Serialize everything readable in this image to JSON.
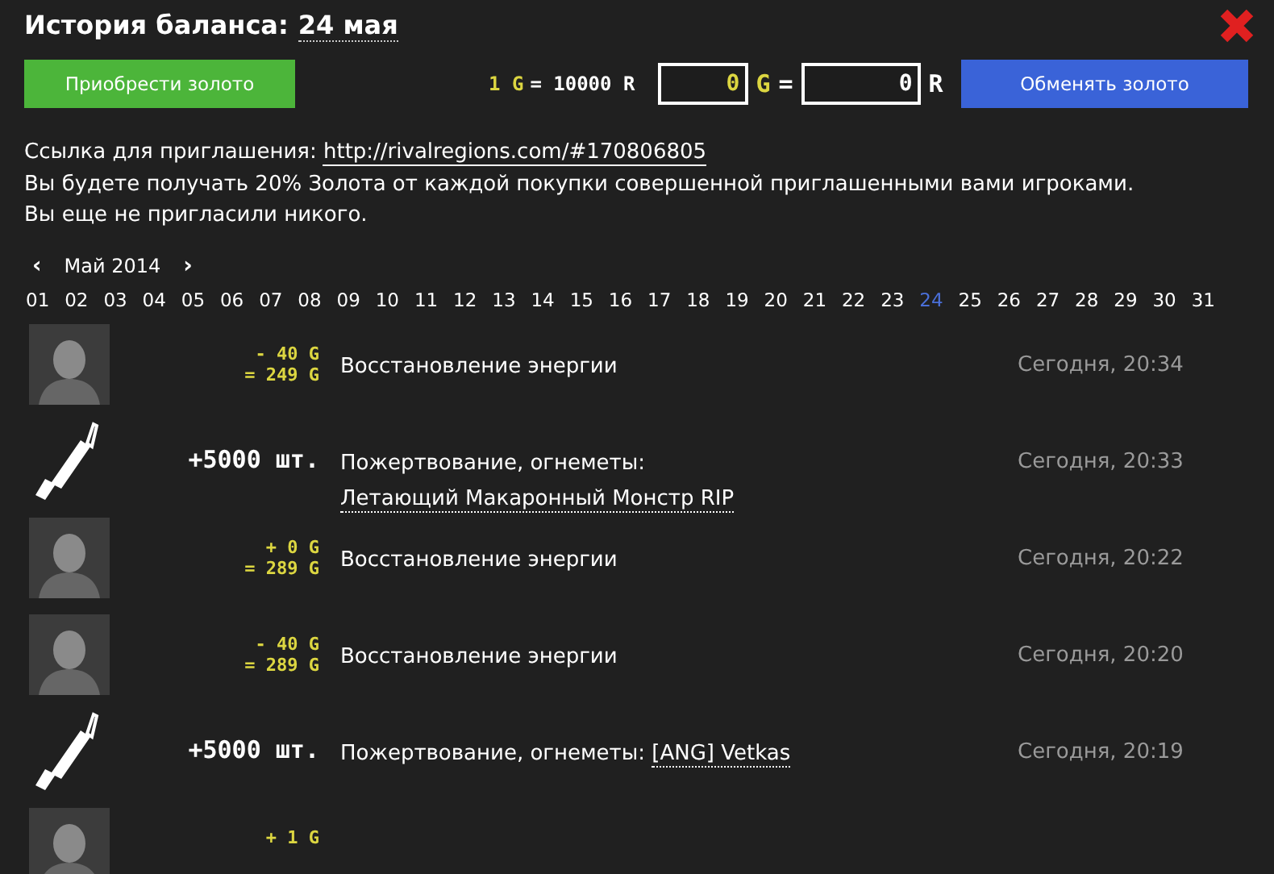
{
  "dialog": {
    "title": "История баланса:",
    "title_date": "24 мая",
    "buy_button": "Приобрести золото",
    "rate": {
      "gold": "1 G",
      "rest": "= 10000 R"
    },
    "exchange": {
      "gold_value": "0",
      "gold_unit": "G",
      "equals": "=",
      "money_value": "0",
      "money_unit": "R",
      "button": "Обменять золото"
    },
    "referral": {
      "label": "Ссылка для приглашения:",
      "link": "http://rivalregions.com/#170806805",
      "lines": [
        "Вы будете получать 20% Золота от каждой покупки совершенной приглашенными вами игроками.",
        "Вы еще не пригласили никого."
      ]
    },
    "calendar": {
      "prev": "‹",
      "month": "Май 2014",
      "next": "›",
      "days": [
        {
          "label": "01",
          "selected": false
        },
        {
          "label": "02",
          "selected": false
        },
        {
          "label": "03",
          "selected": false
        },
        {
          "label": "04",
          "selected": false
        },
        {
          "label": "05",
          "selected": false
        },
        {
          "label": "06",
          "selected": false
        },
        {
          "label": "07",
          "selected": false
        },
        {
          "label": "08",
          "selected": false
        },
        {
          "label": "09",
          "selected": false
        },
        {
          "label": "10",
          "selected": false
        },
        {
          "label": "11",
          "selected": false
        },
        {
          "label": "12",
          "selected": false
        },
        {
          "label": "13",
          "selected": false
        },
        {
          "label": "14",
          "selected": false
        },
        {
          "label": "15",
          "selected": false
        },
        {
          "label": "16",
          "selected": false
        },
        {
          "label": "17",
          "selected": false
        },
        {
          "label": "18",
          "selected": false
        },
        {
          "label": "19",
          "selected": false
        },
        {
          "label": "20",
          "selected": false
        },
        {
          "label": "21",
          "selected": false
        },
        {
          "label": "22",
          "selected": false
        },
        {
          "label": "23",
          "selected": false
        },
        {
          "label": "24",
          "selected": true
        },
        {
          "label": "25",
          "selected": false
        },
        {
          "label": "26",
          "selected": false
        },
        {
          "label": "27",
          "selected": false
        },
        {
          "label": "28",
          "selected": false
        },
        {
          "label": "29",
          "selected": false
        },
        {
          "label": "30",
          "selected": false
        },
        {
          "label": "31",
          "selected": false
        }
      ]
    },
    "transactions": [
      {
        "kind": "gold",
        "amounts": [
          "- 40 G",
          "= 249 G"
        ],
        "description": "Восстановление энергии",
        "time": "Сегодня, 20:34"
      },
      {
        "kind": "item",
        "amounts": [
          "+5000 шт."
        ],
        "description": "Пожертвование, огнеметы:",
        "link": "Летающий Макаронный Монстр RIP",
        "time": "Сегодня, 20:33"
      },
      {
        "kind": "gold",
        "amounts": [
          "+ 0 G",
          "= 289 G"
        ],
        "description": "Восстановление энергии",
        "time": "Сегодня, 20:22"
      },
      {
        "kind": "gold",
        "amounts": [
          "- 40 G",
          "= 289 G"
        ],
        "description": "Восстановление энергии",
        "time": "Сегодня, 20:20"
      },
      {
        "kind": "item",
        "amounts": [
          "+5000 шт."
        ],
        "description": "Пожертвование, огнеметы:",
        "link": "[ANG] Vetkas",
        "time": "Сегодня, 20:19"
      },
      {
        "kind": "gold",
        "amounts": [
          "+ 1 G"
        ]
      }
    ]
  }
}
